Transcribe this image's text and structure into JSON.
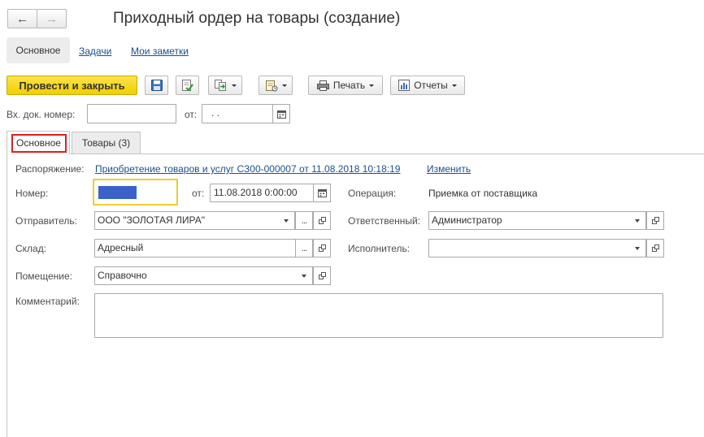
{
  "window": {
    "title": "Приходный ордер на товары (создание)",
    "nav_back": "←",
    "nav_forward": "→"
  },
  "nav_tabs": {
    "main": "Основное",
    "tasks": "Задачи",
    "notes": "Мои заметки"
  },
  "toolbar": {
    "post_close": "Провести и закрыть",
    "print": "Печать",
    "reports": "Отчеты"
  },
  "incoming": {
    "number_label": "Вх. док. номер:",
    "number_value": "",
    "from_label": "от:",
    "date_value": " .  ."
  },
  "tabs": {
    "main": "Основное",
    "goods": "Товары (3)"
  },
  "form": {
    "order_label": "Распоряжение:",
    "order_link": "Приобретение товаров и услуг СЗ00-000007 от 11.08.2018 10:18:19",
    "change_link": "Изменить",
    "number_label": "Номер:",
    "number_value": "",
    "date_label": "от:",
    "date_value": "11.08.2018  0:00:00",
    "operation_label": "Операция:",
    "operation_value": "Приемка от поставщика",
    "sender_label": "Отправитель:",
    "sender_value": "ООО \"ЗОЛОТАЯ ЛИРА\"",
    "responsible_label": "Ответственный:",
    "responsible_value": "Администратор",
    "warehouse_label": "Склад:",
    "warehouse_value": "Адресный",
    "executor_label": "Исполнитель:",
    "executor_value": "",
    "room_label": "Помещение:",
    "room_value": "Справочно",
    "comment_label": "Комментарий:",
    "comment_value": ""
  },
  "colors": {
    "primary_button": "#f5d800",
    "link": "#1c4f8f",
    "active_tab_highlight": "#e0201b",
    "focus_border": "#e8cf2e",
    "redaction": "#3a62c8"
  }
}
